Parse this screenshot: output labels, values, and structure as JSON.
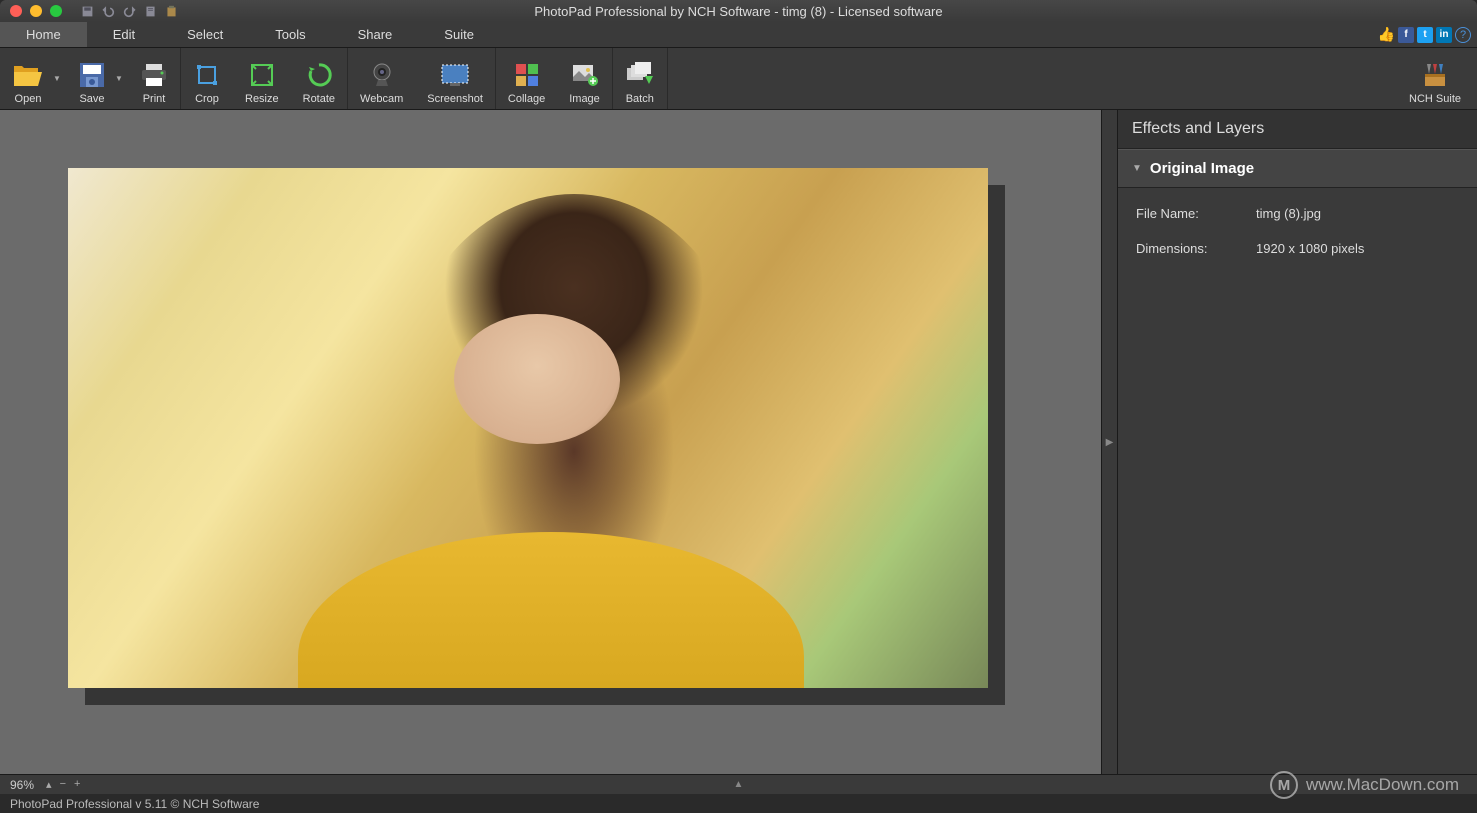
{
  "title": "PhotoPad Professional by NCH Software - timg (8) - Licensed software",
  "menu_tabs": [
    "Home",
    "Edit",
    "Select",
    "Tools",
    "Share",
    "Suite"
  ],
  "menu_active": 0,
  "ribbon": {
    "open": "Open",
    "save": "Save",
    "print": "Print",
    "crop": "Crop",
    "resize": "Resize",
    "rotate": "Rotate",
    "webcam": "Webcam",
    "screenshot": "Screenshot",
    "collage": "Collage",
    "image": "Image",
    "batch": "Batch",
    "suite": "NCH Suite"
  },
  "panel": {
    "title": "Effects and Layers",
    "section": "Original Image",
    "file_label": "File Name:",
    "file_value": "timg (8).jpg",
    "dim_label": "Dimensions:",
    "dim_value": "1920 x 1080 pixels"
  },
  "zoom": "96%",
  "status": "PhotoPad Professional v 5.11 © NCH Software",
  "watermark": "www.MacDown.com"
}
